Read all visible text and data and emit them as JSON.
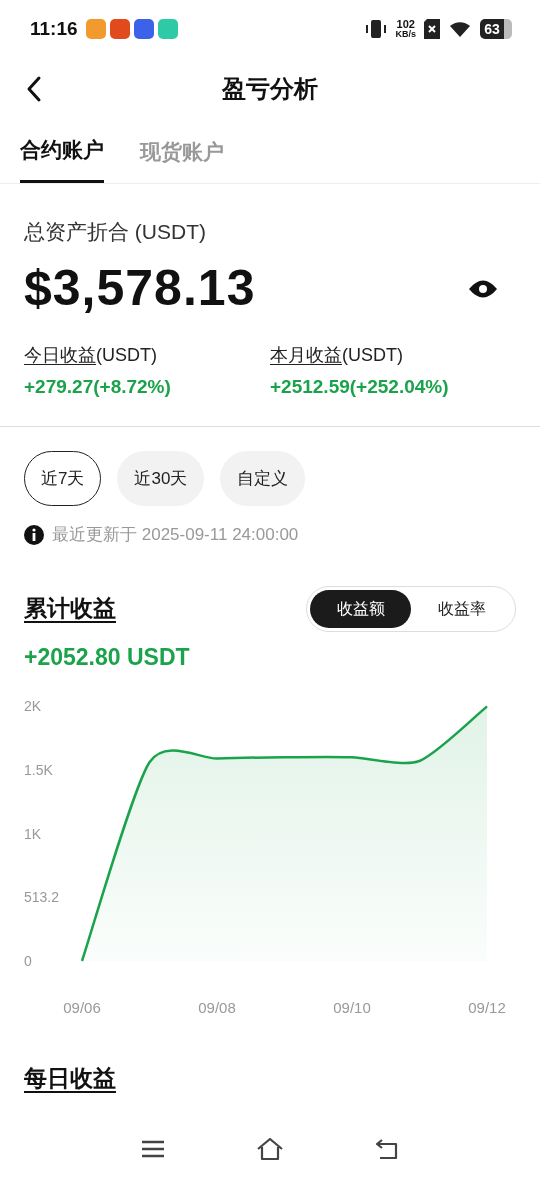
{
  "status_bar": {
    "time": "11:16",
    "net_speed": "102",
    "net_unit": "KB/s",
    "battery": "63"
  },
  "header": {
    "title": "盈亏分析"
  },
  "tabs": [
    {
      "label": "合约账户",
      "selected": true
    },
    {
      "label": "现货账户",
      "selected": false
    }
  ],
  "total": {
    "label": "总资产折合 (USDT)",
    "amount": "$3,578.13"
  },
  "earnings": [
    {
      "label": "今日收益",
      "unit": "(USDT)",
      "value": "+279.27(+8.72%)"
    },
    {
      "label": "本月收益",
      "unit": "(USDT)",
      "value": "+2512.59(+252.04%)"
    }
  ],
  "periods": [
    {
      "label": "近7天",
      "selected": true
    },
    {
      "label": "近30天",
      "selected": false
    },
    {
      "label": "自定义",
      "selected": false
    }
  ],
  "update_note": "最近更新于 2025-09-11 24:00:00",
  "cumulative": {
    "title": "累计收益",
    "modes": [
      {
        "label": "收益额",
        "selected": true
      },
      {
        "label": "收益率",
        "selected": false
      }
    ],
    "amount": "+2052.80 USDT",
    "chart_data": {
      "type": "area",
      "categories": [
        "09/06",
        null,
        "09/08",
        null,
        "09/10",
        null,
        "09/12"
      ],
      "series": [
        {
          "color": "#1aa34a",
          "values": [
            0,
            1600,
            1630,
            1640,
            1640,
            1610,
            2050
          ]
        }
      ],
      "ylim": [
        0,
        2052.8
      ],
      "yticks": [
        {
          "value": 0,
          "label": "0"
        },
        {
          "value": 513.2,
          "label": "513.2"
        },
        {
          "value": 1026.4,
          "label": "1K"
        },
        {
          "value": 1539.6,
          "label": "1.5K"
        },
        {
          "value": 2052.8,
          "label": "2K"
        }
      ]
    }
  },
  "daily": {
    "title": "每日收益"
  }
}
